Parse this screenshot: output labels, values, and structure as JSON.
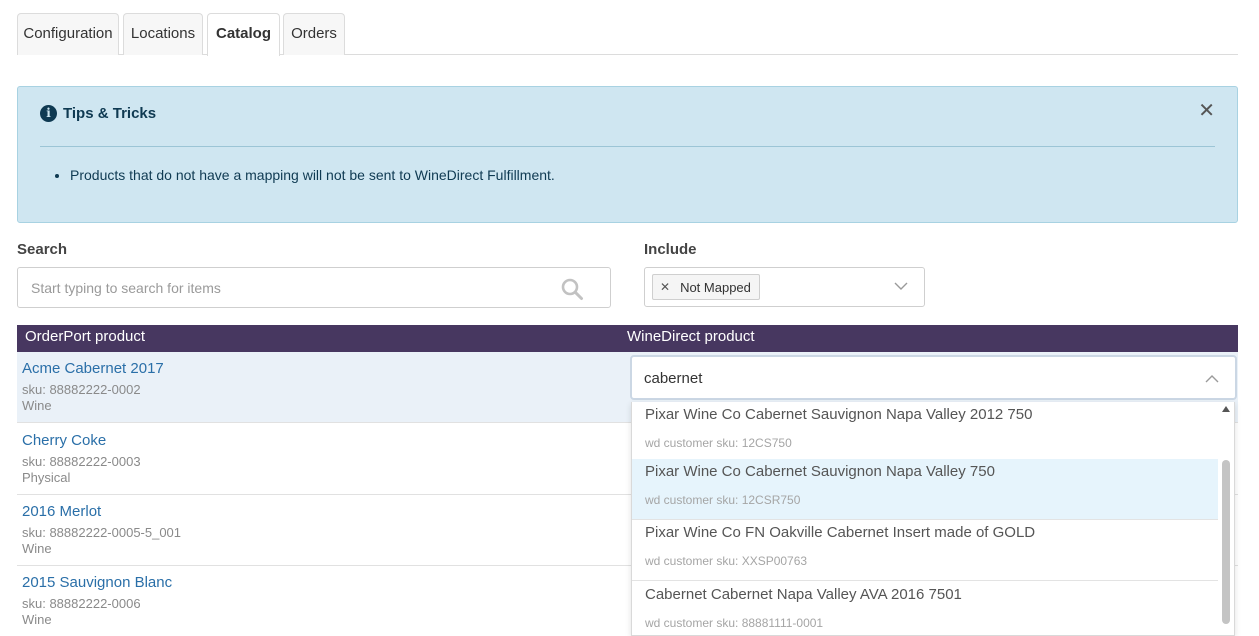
{
  "tabs": [
    {
      "label": "Configuration"
    },
    {
      "label": "Locations"
    },
    {
      "label": "Catalog"
    },
    {
      "label": "Orders"
    }
  ],
  "active_tab": "Catalog",
  "tips": {
    "title": "Tips & Tricks",
    "close_icon": "close-icon",
    "items": [
      "Products that do not have a mapping will not be sent to WineDirect Fulfillment."
    ]
  },
  "search": {
    "label": "Search",
    "placeholder": "Start typing to search for items",
    "value": ""
  },
  "include": {
    "label": "Include",
    "selected": [
      "Not Mapped"
    ]
  },
  "table": {
    "columns": [
      "OrderPort product",
      "WineDirect product"
    ],
    "rows": [
      {
        "name": "Acme Cabernet 2017",
        "sku": "sku: 88882222-0002",
        "type": "Wine"
      },
      {
        "name": "Cherry Coke",
        "sku": "sku: 88882222-0003",
        "type": "Physical"
      },
      {
        "name": "2016 Merlot",
        "sku": "sku: 88882222-0005-5_001",
        "type": "Wine"
      },
      {
        "name": "2015 Sauvignon Blanc",
        "sku": "sku: 88882222-0006",
        "type": "Wine"
      }
    ]
  },
  "combo": {
    "value": "cabernet",
    "options": [
      {
        "name": "Pixar Wine Co Cabernet Sauvignon Napa Valley 2012 750",
        "sku": "wd customer sku: 12CS750"
      },
      {
        "name": "Pixar Wine Co Cabernet Sauvignon Napa Valley 750",
        "sku": "wd customer sku: 12CSR750"
      },
      {
        "name": "Pixar Wine Co FN Oakville Cabernet Insert made of GOLD",
        "sku": "wd customer sku: XXSP00763"
      },
      {
        "name": "Cabernet Cabernet Napa Valley AVA 2016 7501",
        "sku": "wd customer sku: 88881111-0001"
      }
    ]
  },
  "colors": {
    "header_bg": "#473760",
    "tips_bg": "#cfe6f1",
    "link": "#2a6fa8",
    "highlight": "#e6f4fc"
  }
}
